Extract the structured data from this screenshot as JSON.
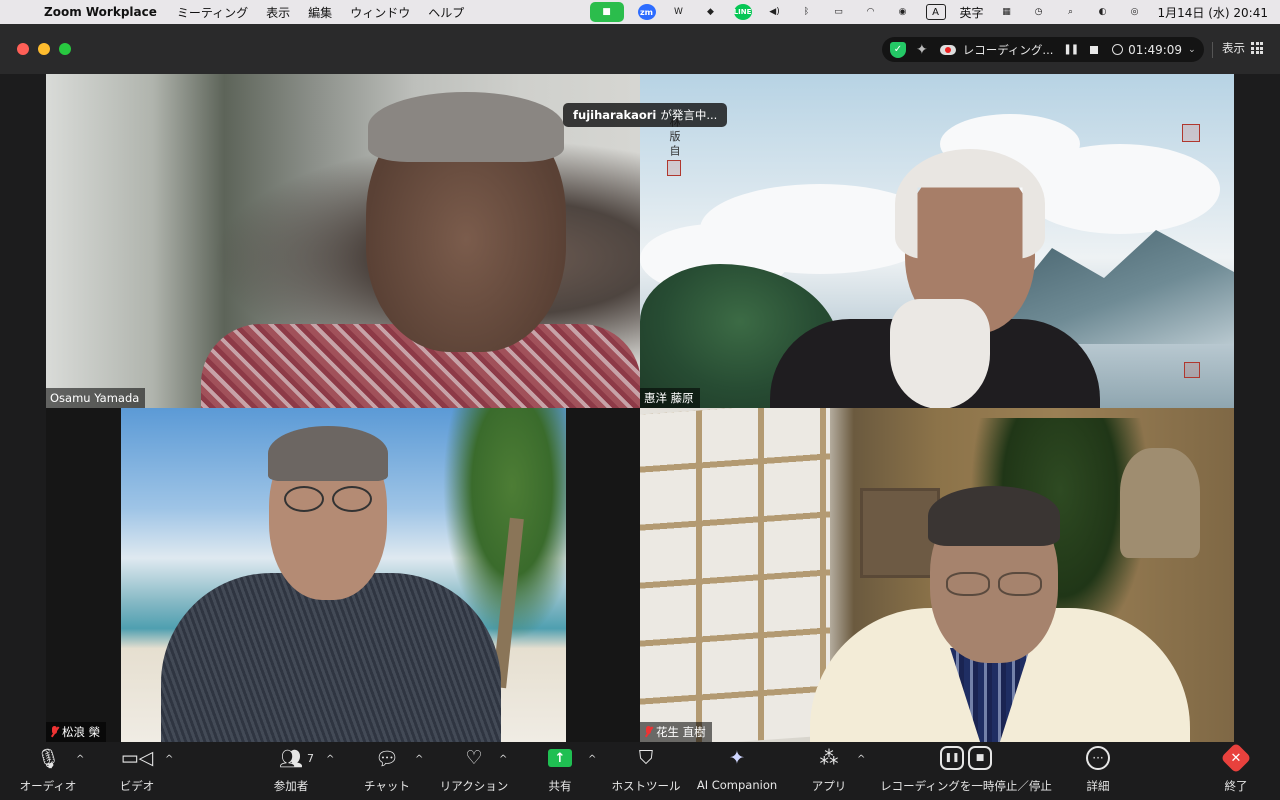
{
  "menubar": {
    "app_name": "Zoom Workplace",
    "menus": [
      "ミーティング",
      "表示",
      "編集",
      "ウィンドウ",
      "ヘルプ"
    ],
    "tray": {
      "zm": "zm",
      "line": "LINE",
      "input_mode_key": "A",
      "input_mode_label": "英字"
    },
    "datetime": "1月14日 (水)  20:41"
  },
  "titlebar": {
    "recording_label": "レコーディング...",
    "timer": "01:49:09",
    "view_label": "表示"
  },
  "speaking_banner": {
    "name": "fujiharakaori",
    "suffix": "が発言中..."
  },
  "tiles": [
    {
      "name": "Osamu Yamada",
      "muted": false
    },
    {
      "name": "惠洋 藤原",
      "muted": false
    },
    {
      "name": "松浪 榮",
      "muted": true
    },
    {
      "name": "花生 直樹",
      "muted": true
    }
  ],
  "background_text": {
    "calligraphy": "林  版  自"
  },
  "toolbar": {
    "audio": "オーディオ",
    "video": "ビデオ",
    "participants": "参加者",
    "participants_count": "7",
    "chat": "チャット",
    "reactions": "リアクション",
    "share": "共有",
    "host_tools": "ホストツール",
    "ai_companion": "AI Companion",
    "apps": "アプリ",
    "recording": "レコーディングを一時停止／停止",
    "more": "詳細",
    "end": "終了"
  },
  "colors": {
    "share_green": "#1fbf52",
    "end_red": "#e8413d",
    "mute_red": "#e33333",
    "shield_green": "#24c866"
  }
}
